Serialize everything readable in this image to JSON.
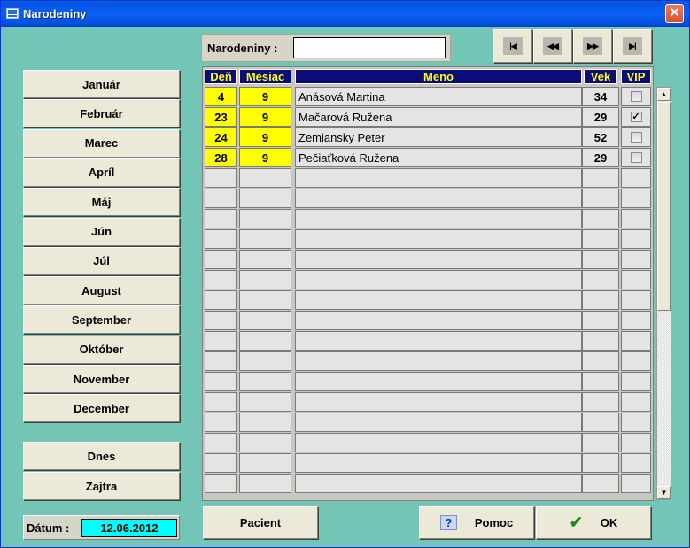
{
  "window": {
    "title": "Narodeniny",
    "close_glyph": "✕"
  },
  "search": {
    "label": "Narodeniny :",
    "value": ""
  },
  "nav": [
    {
      "name": "first-record-button",
      "glyph": "|◀"
    },
    {
      "name": "prev-record-button",
      "glyph": "◀◀"
    },
    {
      "name": "next-record-button",
      "glyph": "▶▶"
    },
    {
      "name": "last-record-button",
      "glyph": "▶|"
    }
  ],
  "months": [
    "Január",
    "Február",
    "Marec",
    "Apríl",
    "Máj",
    "Jún",
    "Júl",
    "August",
    "September",
    "Október",
    "November",
    "December"
  ],
  "quick": {
    "today": "Dnes",
    "tomorrow": "Zajtra"
  },
  "date": {
    "label": "Dátum :",
    "value": "12.06.2012"
  },
  "grid": {
    "headers": {
      "day": "Deň",
      "month": "Mesiac",
      "name": "Meno",
      "age": "Vek",
      "vip": "VIP"
    },
    "rows": [
      {
        "day": "4",
        "month": "9",
        "name": "Anásová Martina",
        "age": "34",
        "vip": false
      },
      {
        "day": "23",
        "month": "9",
        "name": "Mačarová Ružena",
        "age": "29",
        "vip": true
      },
      {
        "day": "24",
        "month": "9",
        "name": "Zemiansky Peter",
        "age": "52",
        "vip": false
      },
      {
        "day": "28",
        "month": "9",
        "name": "Pečiaťková Ružena",
        "age": "29",
        "vip": false
      }
    ],
    "check_glyph": "✓"
  },
  "buttons": {
    "patient": "Pacient",
    "help": "Pomoc",
    "ok": "OK",
    "help_icon": "?",
    "ok_icon": "✔"
  },
  "colors": {
    "header_bg": "#0b0b7a",
    "header_text": "#ffff00",
    "date_bg": "#00ffff",
    "highlight": "#ffff00"
  }
}
